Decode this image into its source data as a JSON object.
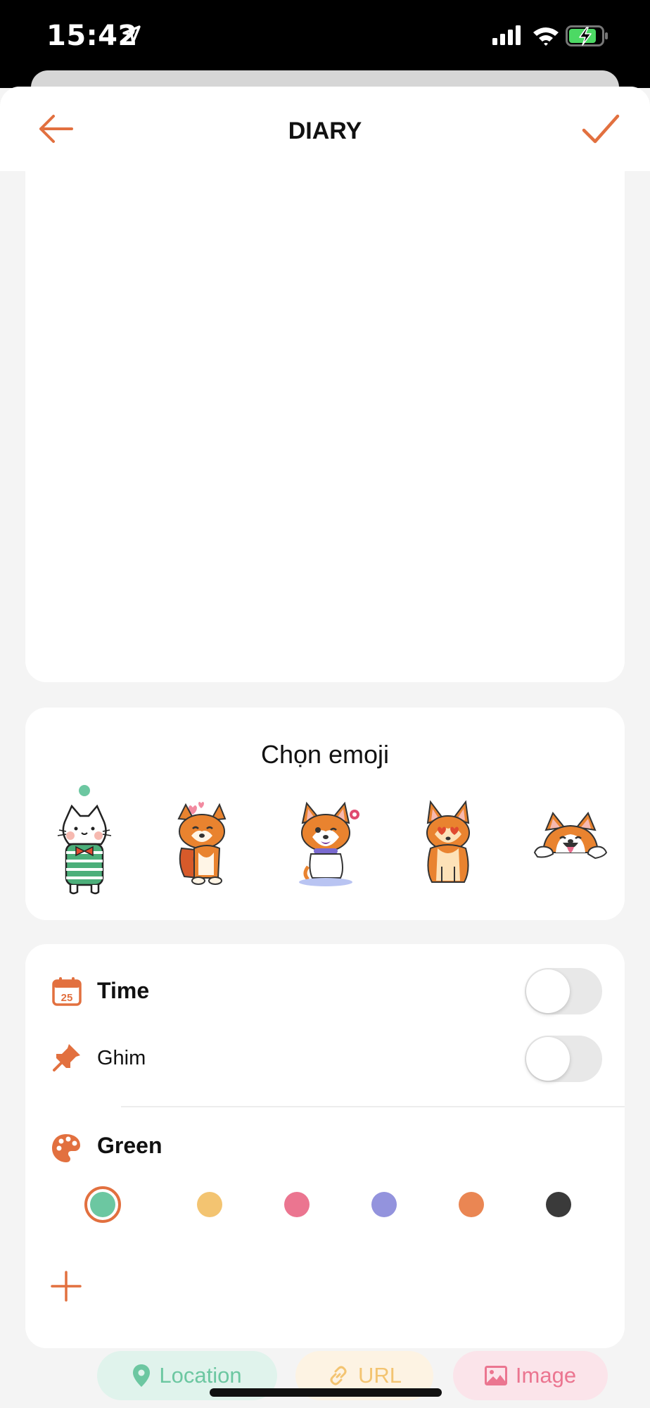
{
  "status_bar": {
    "time": "15:42"
  },
  "header": {
    "title": "DIARY"
  },
  "emoji_picker": {
    "title": "Chọn emoji",
    "items": [
      "cat-sweater-sticker",
      "corgi-love-sticker",
      "corgi-wink-sticker",
      "corgi-heart-eyes-sticker",
      "corgi-peek-sticker"
    ],
    "selected_index": 0
  },
  "settings": {
    "time_label": "Time",
    "time_enabled": false,
    "pin_label": "Ghim",
    "pin_enabled": false,
    "color_label": "Green",
    "colors": [
      "#6cc7a1",
      "#f3c471",
      "#eb7590",
      "#9393dd",
      "#ea8653",
      "#3a3a3a"
    ],
    "selected_color_index": 0
  },
  "attachments": {
    "location_label": "Location",
    "url_label": "URL",
    "image_label": "Image",
    "location_bg": "#e0f3ec",
    "location_fg": "#6cc7a1",
    "url_bg": "#fdf3e3",
    "url_fg": "#f3c471",
    "image_bg": "#fbe4ea",
    "image_fg": "#eb7590"
  },
  "accent_color": "#e2703f"
}
